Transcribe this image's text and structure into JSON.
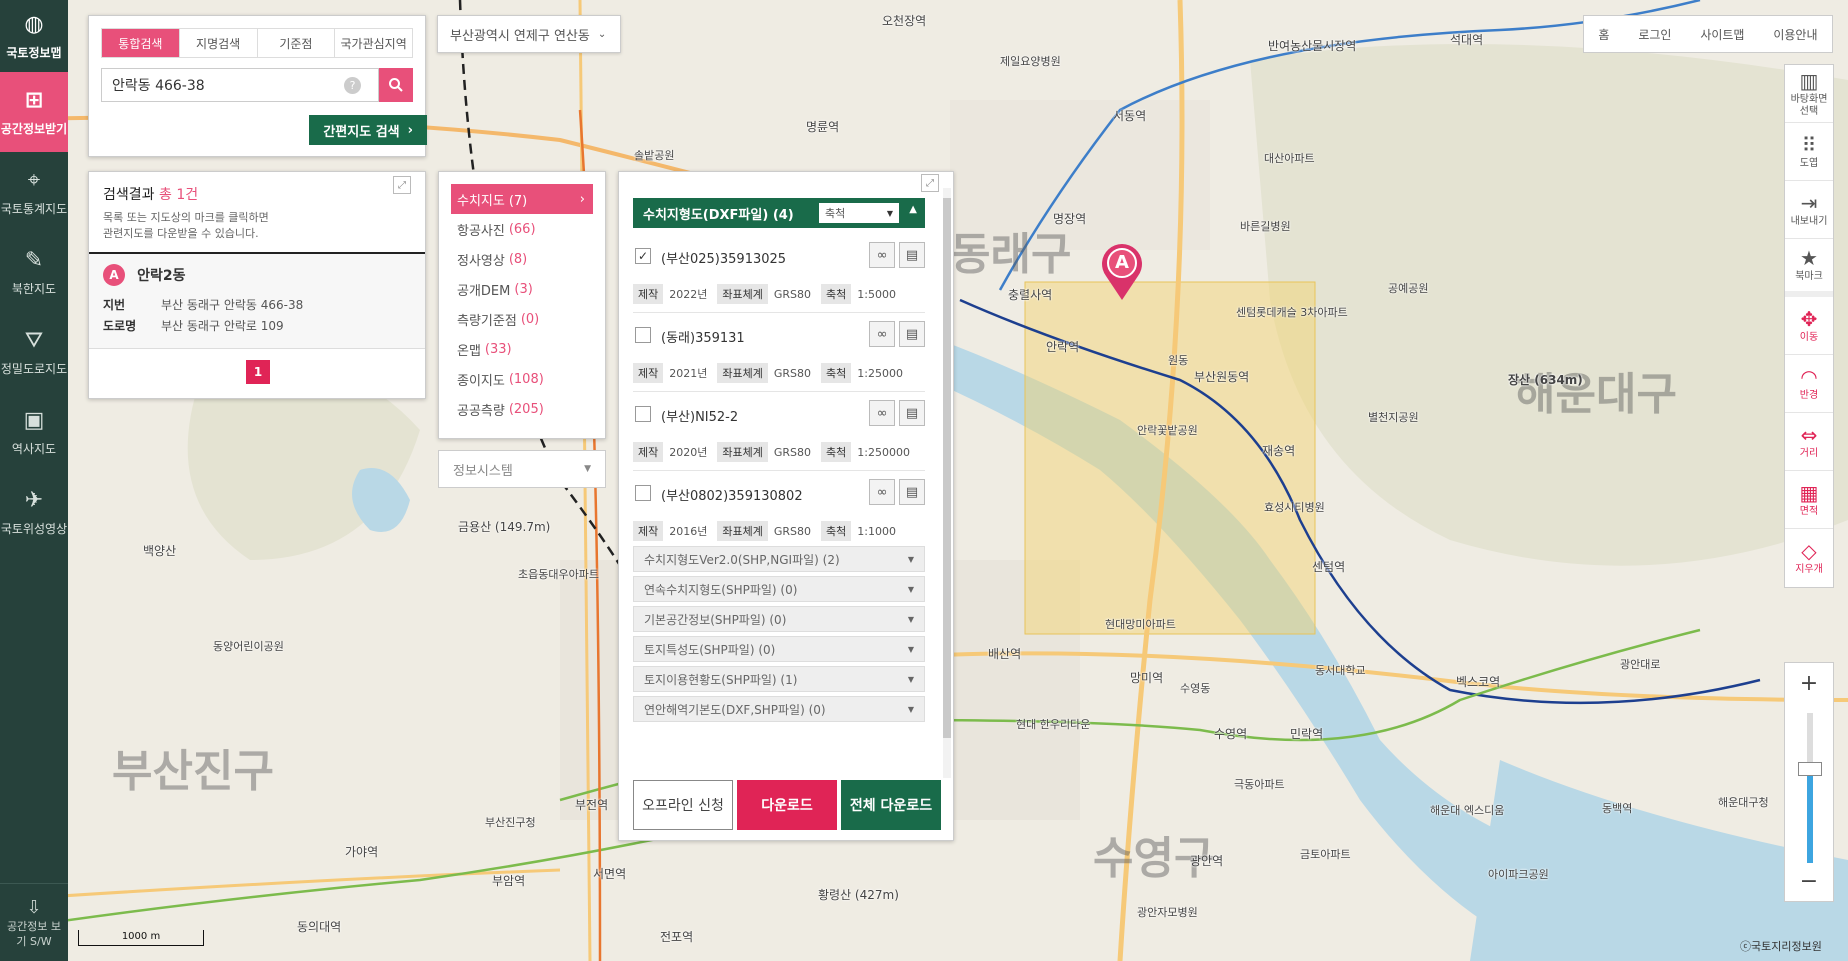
{
  "nav": {
    "logo": "국토정보맵",
    "items": [
      {
        "label": "공간정보받기",
        "icon": "download-map-icon"
      },
      {
        "label": "국토통계지도",
        "icon": "stats-map-icon"
      },
      {
        "label": "북한지도",
        "icon": "north-korea-map-icon"
      },
      {
        "label": "정밀도로지도",
        "icon": "road-map-icon"
      },
      {
        "label": "역사지도",
        "icon": "history-map-icon"
      },
      {
        "label": "국토위성영상",
        "icon": "satellite-icon"
      }
    ],
    "bottom_label": "공간정보 보기 S/W"
  },
  "search": {
    "tabs": [
      "통합검색",
      "지명검색",
      "기준점",
      "국가관심지역"
    ],
    "active_tab": 0,
    "value": "안락동 466-38",
    "help": "?",
    "map_search_label": "간편지도 검색"
  },
  "results": {
    "title_prefix": "검색결과",
    "count": "총 1건",
    "desc1": "목록 또는 지도상의 마크를 클릭하면",
    "desc2": "관련지도를 다운받을 수 있습니다.",
    "item": {
      "marker": "A",
      "name": "안락2동",
      "jibun_label": "지번",
      "jibun": "부산 동래구 안락동 466-38",
      "road_label": "도로명",
      "road": "부산 동래구 안락로 109"
    },
    "page": "1"
  },
  "region": {
    "label": "부산광역시 연제구 연산동"
  },
  "categories": [
    {
      "label": "수치지도",
      "count": "(7)"
    },
    {
      "label": "항공사진",
      "count": "(66)"
    },
    {
      "label": "정사영상",
      "count": "(8)"
    },
    {
      "label": "공개DEM",
      "count": "(3)"
    },
    {
      "label": "측량기준점",
      "count": "(0)"
    },
    {
      "label": "온맵",
      "count": "(33)"
    },
    {
      "label": "종이지도",
      "count": "(108)"
    },
    {
      "label": "공공측량",
      "count": "(205)"
    }
  ],
  "infosys": {
    "label": "정보시스템"
  },
  "download": {
    "header": "수치지형도(DXF파일) (4)",
    "scale_label": "축척",
    "entries": [
      {
        "name": "(부산025)35913025",
        "checked": true,
        "year": "2022년",
        "crs": "GRS80",
        "scale": "1:5000"
      },
      {
        "name": "(동래)359131",
        "checked": false,
        "year": "2021년",
        "crs": "GRS80",
        "scale": "1:25000"
      },
      {
        "name": "(부산)NI52-2",
        "checked": false,
        "year": "2020년",
        "crs": "GRS80",
        "scale": "1:250000"
      },
      {
        "name": "(부산0802)359130802",
        "checked": false,
        "year": "2016년",
        "crs": "GRS80",
        "scale": "1:1000"
      }
    ],
    "meta_labels": {
      "year": "제작",
      "crs": "좌표체계",
      "scale": "축척"
    },
    "dropdowns": [
      "수치지형도Ver2.0(SHP,NGI파일) (2)",
      "연속수치지형도(SHP파일) (0)",
      "기본공간정보(SHP파일) (0)",
      "토지특성도(SHP파일) (0)",
      "토지이용현황도(SHP파일) (1)",
      "연안해역기본도(DXF,SHP파일) (0)"
    ],
    "btn_offline": "오프라인 신청",
    "btn_download": "다운로드",
    "btn_download_all": "전체 다운로드"
  },
  "toplinks": [
    "홈",
    "로그인",
    "사이트맵",
    "이용안내"
  ],
  "tools": [
    {
      "label": "바탕화면 선택",
      "icon": "map-book-icon"
    },
    {
      "label": "도엽",
      "icon": "grid-icon"
    },
    {
      "label": "내보내기",
      "icon": "export-icon"
    },
    {
      "label": "북마크",
      "icon": "star-icon"
    },
    {
      "label": "이동",
      "icon": "move-icon"
    },
    {
      "label": "반경",
      "icon": "radius-icon"
    },
    {
      "label": "거리",
      "icon": "distance-icon"
    },
    {
      "label": "면적",
      "icon": "area-icon"
    },
    {
      "label": "지우개",
      "icon": "eraser-icon"
    }
  ],
  "zoom": {
    "in": "+",
    "out": "−",
    "level_fraction": 0.63
  },
  "map": {
    "marker": "A",
    "scale": "1000 m",
    "copyright": "ⓒ국토지리정보원",
    "labels": {
      "district1": "동래구",
      "district2": "해운대구",
      "district3": "부산진구",
      "district4": "수영구",
      "s1": "오천장역",
      "s2": "서동역",
      "s3": "명장역",
      "s4": "충렬사역",
      "s5": "안락역",
      "s6": "부산원동역",
      "s7": "재송역",
      "s8": "센텀역",
      "s9": "벡스코역",
      "s10": "수영역",
      "s11": "망미역",
      "s12": "배산역",
      "s13": "민락역",
      "s14": "광안역",
      "s15": "서면역",
      "s16": "부전역",
      "s17": "가야역",
      "s18": "부암역",
      "s19": "동의대역",
      "s20": "전포역",
      "s21": "명륜역",
      "s22": "석대역",
      "s23": "반여농산물시장역",
      "p1": "장산 (634m)",
      "p2": "금용산 (149.7m)",
      "p3": "황령산 (427m)",
      "p4": "백양산",
      "f1": "안락꽃밭공원",
      "f2": "센텀롯데캐슬 3차아파트",
      "f3": "원동",
      "f4": "부산진구청",
      "f5": "동서대학교",
      "f6": "현대망미아파트",
      "f7": "극동아파트",
      "f8": "금토아파트",
      "f9": "초읍동대우아파트",
      "f10": "동양어린이공원",
      "f11": "제일요양병원",
      "f12": "솔밭공원",
      "f13": "대산아파트",
      "f14": "바른길병원",
      "f15": "공예공원",
      "f16": "별천지공원",
      "f17": "해운대 엑스디움",
      "f18": "아이파크공원",
      "f19": "광안자모병원",
      "f20": "수영동",
      "f21": "광안대로",
      "f22": "해운대구청",
      "f23": "동백역",
      "f24": "효성시티병원",
      "f25": "현대 한우리타운"
    }
  }
}
